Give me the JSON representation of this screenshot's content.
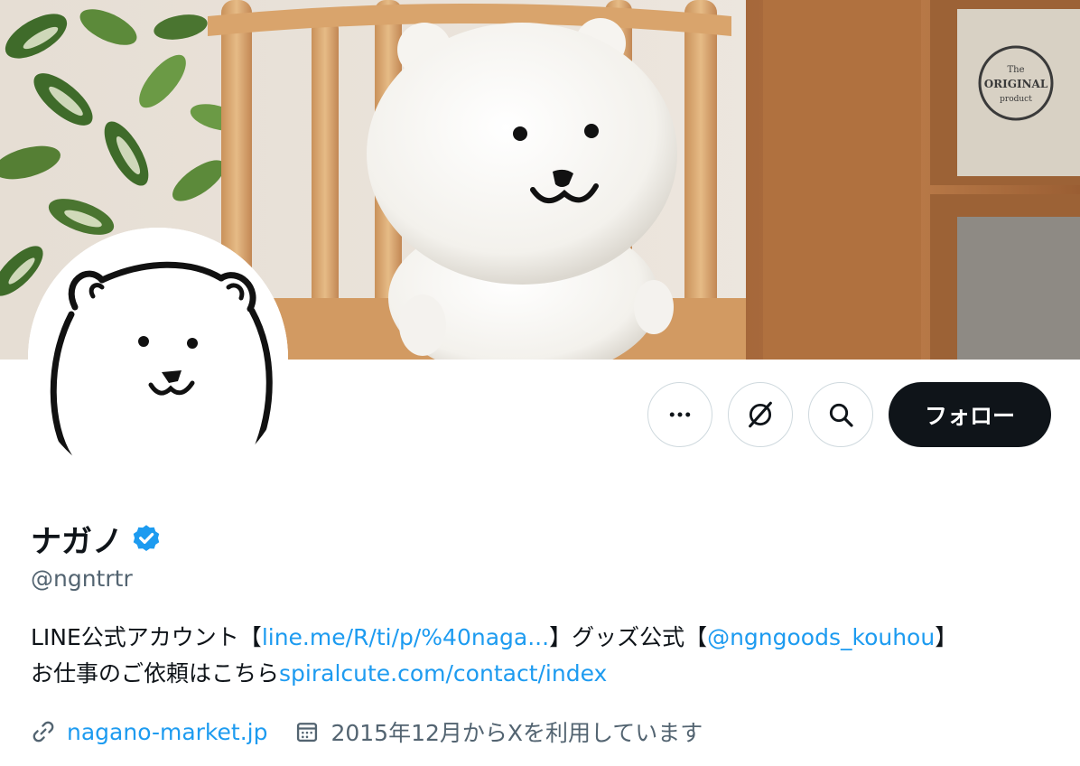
{
  "profile": {
    "display_name": "ナガノ",
    "handle": "@ngntrtr",
    "verified": true,
    "verified_color": "#1d9bf0"
  },
  "actions": {
    "more_icon": "more-horizontal-icon",
    "grok_icon": "grok-icon",
    "search_icon": "search-icon",
    "follow_label": "フォロー"
  },
  "bio": {
    "part1": "LINE公式アカウント【",
    "link1": "line.me/R/ti/p/%40naga...",
    "part2": "】グッズ公式【",
    "link2": "@ngngoods_kouhou",
    "part3": "】",
    "part4": "お仕事のご依頼はこちら",
    "link3": "spiralcute.com/contact/index"
  },
  "meta": {
    "website": "nagano-market.jp",
    "joined": "2015年12月からXを利用しています",
    "link_icon": "link-icon",
    "calendar_icon": "calendar-icon"
  },
  "banner": {
    "stamp_text_1": "The",
    "stamp_text_2": "ORIGINAL",
    "stamp_text_3": "product"
  },
  "colors": {
    "accent": "#1d9bf0",
    "text_primary": "#0f1419",
    "text_secondary": "#536471",
    "follow_bg": "#0f1419"
  }
}
